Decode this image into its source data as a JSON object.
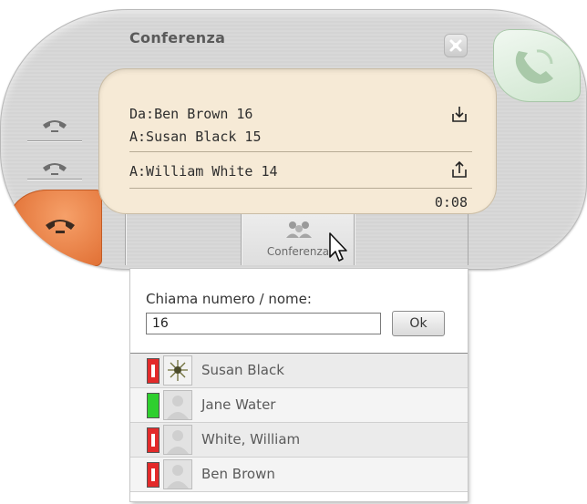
{
  "window": {
    "title": "Conferenza"
  },
  "call": {
    "from_line": "Da:Ben Brown 16",
    "to_line_1": "A:Susan Black 15",
    "to_line_2": "A:William White 14",
    "timer": "0:08"
  },
  "tabs": {
    "conference_label": "Conferenza"
  },
  "dialer": {
    "label": "Chiama numero / nome:",
    "input_value": "16",
    "ok_label": "Ok"
  },
  "contacts": [
    {
      "name": "Susan Black",
      "status": "busy",
      "avatar": "photo"
    },
    {
      "name": "Jane Water",
      "status": "available",
      "avatar": "placeholder"
    },
    {
      "name": "White, William",
      "status": "busy",
      "avatar": "placeholder"
    },
    {
      "name": "Ben Brown",
      "status": "busy",
      "avatar": "placeholder"
    }
  ],
  "colors": {
    "accent_orange": "#e4773c",
    "answer_green": "#cfe6cf",
    "display_beige": "#f6ead6",
    "status_busy": "#e32a2a",
    "status_available": "#2fcf2f"
  },
  "icons": {
    "close": "close-icon",
    "answer": "phone-answer-icon",
    "line": "phone-line-icon",
    "hangup": "phone-hangup-icon",
    "incoming": "download-icon",
    "outgoing": "upload-icon",
    "conference": "conference-icon",
    "cursor": "mouse-pointer-icon"
  }
}
